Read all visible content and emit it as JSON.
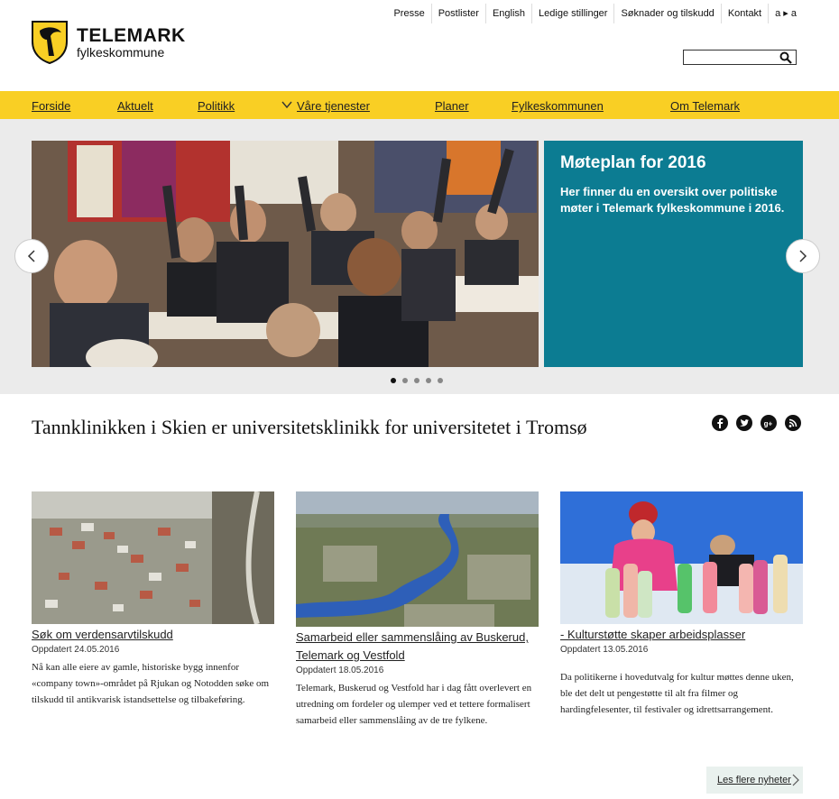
{
  "logo": {
    "title": "TELEMARK",
    "subtitle": "fylkeskommune"
  },
  "toplinks": [
    "Presse",
    "Postlister",
    "English",
    "Ledige stillinger",
    "Søknader og tilskudd",
    "Kontakt",
    "a ▸ a"
  ],
  "search": {
    "placeholder": "",
    "value": ""
  },
  "nav": {
    "forside": "Forside",
    "aktuelt": "Aktuelt",
    "politikk": "Politikk",
    "tjenester": "Våre tjenester",
    "planer": "Planer",
    "fylkeskommunen": "Fylkeskommunen",
    "om": "Om Telemark"
  },
  "slider": {
    "title": "Møteplan for 2016",
    "text": "Her finner du en oversikt over politiske møter i Telemark fylkeskommune i 2016.",
    "active_dot": 1,
    "dot_count": 5
  },
  "headline": "Tannklinikken i Skien er universitetsklinikk for universitetet i Tromsø",
  "social_icons": [
    "facebook-icon",
    "twitter-icon",
    "googleplus-icon",
    "rss-icon"
  ],
  "news": [
    {
      "title": "Søk om verdensarvtilskudd",
      "date": "Oppdatert 24.05.2016",
      "body": "Nå kan alle eiere av gamle, historiske bygg innenfor «company town»-området på Rjukan og Notodden søke om tilskudd til antikvarisk istandsettelse og tilbakeføring."
    },
    {
      "title": "Samarbeid eller sammenslåing av Buskerud, Telemark og Vestfold",
      "date": "Oppdatert 18.05.2016",
      "body": "Telemark, Buskerud og Vestfold har i dag fått overlevert en utredning om fordeler og ulemper ved et tettere formalisert samarbeid eller sammenslåing av de tre fylkene."
    },
    {
      "title": "- Kulturstøtte skaper arbeidsplasser",
      "date": "Oppdatert 13.05.2016",
      "body": "Da politikerne i hovedutvalg for kultur møttes denne uken, ble det delt ut pengestøtte til alt fra filmer og hardingfelesenter, til festivaler og idrettsarrangement."
    }
  ],
  "more_news": "Les flere nyheter",
  "colors": {
    "nav": "#f9cf24",
    "panel": "#0c7c92",
    "more_bg": "#e9f1ee"
  }
}
